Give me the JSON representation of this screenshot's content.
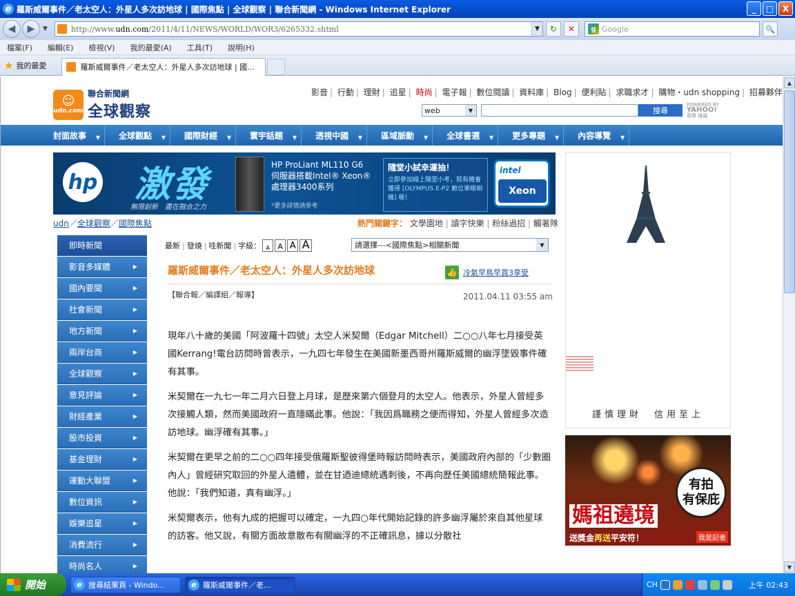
{
  "window": {
    "title": "羅斯威爾事件／老太空人：外星人多次訪地球 | 國際焦點 | 全球觀察 | 聯合新聞網 - Windows Internet Explorer",
    "min_label": "_",
    "max_label": "□",
    "close_label": "X"
  },
  "browser": {
    "address_prefix": "http://www.",
    "address_domain": "udn.com",
    "address_path": "/2011/4/11/NEWS/WORLD/WOR3/6265332.shtml",
    "search_placeholder": "Google",
    "menu": [
      "檔案(F)",
      "編輯(E)",
      "檢視(V)",
      "我的最愛(A)",
      "工具(T)",
      "說明(H)"
    ],
    "favorites_label": "我的最愛",
    "tab_title": "羅斯威爾事件／老太空人：外星人多次訪地球 | 國..."
  },
  "site": {
    "logo_top": "聯合新聞網",
    "logo_main": "全球觀察",
    "logo_icon_text": "udn.com",
    "top_links": [
      "影音",
      "行動",
      "理財",
      "追星",
      "時尚",
      "電子報",
      "數位閱讀",
      "資料庫",
      "Blog",
      "便利貼",
      "求職求才",
      "購物・udn shopping",
      "招募夥伴"
    ],
    "search_scope": "web",
    "search_button": "搜尋",
    "powered_by": "POWERED BY",
    "yahoo": "YAHOO!",
    "yahoo_sub": "奇摩 搜尋",
    "nav": [
      "封面故事",
      "全球觀點",
      "國際財經",
      "寰宇話題",
      "透視中國",
      "區域脈動",
      "全球書選",
      "更多專題",
      "內容導覽"
    ]
  },
  "banner": {
    "brand": "hp",
    "headline": "激發",
    "slogan": "無限創新　盡在融合之力",
    "product_line1": "HP ProLiant ML110 G6",
    "product_line2": "伺服器搭載Intel® Xeon®",
    "product_line3": "處理器3400系列",
    "more": "*更多詳情請參考",
    "promo_head": "隨堂小試幸運抽！",
    "promo_text": "立即參加線上隨堂小考，就有機會獲得 [OLYMPUS E-P2 數位單眼相機] 喔！",
    "intel_top": "intel",
    "intel_main": "Xeon",
    "intel_sub": "inside"
  },
  "breadcrumb": {
    "items": [
      "udn",
      "全球觀察",
      "國際焦點"
    ],
    "sep": "／"
  },
  "keywords": {
    "label": "熱門關鍵字：",
    "items": [
      "文學園地",
      "讀字快樂",
      "粉絲過招",
      "觸著隊"
    ]
  },
  "leftnav": [
    "即時新聞",
    "影音多媒體",
    "國內要聞",
    "社會新聞",
    "地方新聞",
    "兩岸台商",
    "全球觀察",
    "意見評論",
    "財經產業",
    "股市投資",
    "基金理財",
    "運動大聯盟",
    "數位資訊",
    "娛樂追星",
    "消費流行",
    "時尚名人"
  ],
  "article": {
    "tools": [
      "最新",
      "發燒",
      "哇新聞"
    ],
    "font_label": "字級：",
    "font_sizes": [
      "A",
      "A",
      "A",
      "A"
    ],
    "related_select": "請選擇---<國際焦點>相關新聞",
    "title": "羅斯威爾事件／老太空人：外星人多次訪地球",
    "like_text": "冷氣早鳥早買3享受",
    "byline": "【聯合報／編譯組／報導】",
    "date": "2011.04.11 03:55 am",
    "paragraphs": [
      "現年八十歲的美國「阿波羅十四號」太空人米契爾（Edgar Mitchell）二○○八年七月接受英國Kerrang!電台訪問時曾表示，一九四七年發生在美國新墨西哥州羅斯威爾的幽浮墜毀事件確有其事。",
      "米契爾在一九七一年二月六日登上月球，是歷來第六個登月的太空人。他表示，外星人曾經多次接觸人類，然而美國政府一直隱瞞此事。他說：「我因爲職務之便而得知，外星人曾經多次造訪地球。幽浮確有其事。」",
      "米契爾在更早之前的二○○四年接受俄羅斯聖彼得堡時報訪問時表示，美國政府內部的「少數圈內人」曾經研究取回的外星人遺體，並在甘迺迪總統遇刺後，不再向歷任美國總統簡報此事。他說：「我們知道，真有幽浮。」",
      "米契爾表示，他有九成的把握可以確定，一九四○年代開始記錄的許多幽浮屬於來自其他星球的訪客。他又說，有關方面故意散布有關幽浮的不正確訊息，據以分散社"
    ]
  },
  "ads": {
    "eiffel_slogan": "謹慎理財　信用至上",
    "temple_circle_1": "有拍",
    "temple_circle_2": "有保庇",
    "temple_big": "媽祖遶境",
    "temple_small_1": "送獎金",
    "temple_small_2": "再送",
    "temple_small_3": "平安符！",
    "temple_logo": "我是記者"
  },
  "taskbar": {
    "start": "開始",
    "items": [
      "搜尋結果頁 - Windo...",
      "羅斯威爾事件／老..."
    ],
    "lang": "CH",
    "clock": "上午 02:43"
  }
}
